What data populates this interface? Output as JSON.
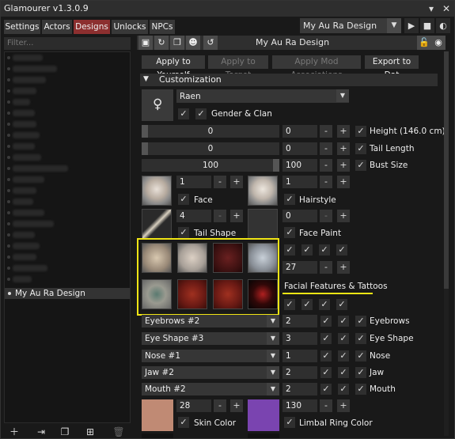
{
  "window": {
    "title": "Glamourer v1.3.0.9"
  },
  "tabs": [
    "Settings",
    "Actors",
    "Designs",
    "Unlocks",
    "NPCs"
  ],
  "active_tab": "Designs",
  "header": {
    "selected_design": "My Au Ra Design"
  },
  "left": {
    "filter_placeholder": "Filter...",
    "selected_item": "My Au Ra Design"
  },
  "right": {
    "title": "My Au Ra Design",
    "buttons": {
      "apply_yourself": "Apply to Yourself",
      "apply_target": "Apply to Target",
      "apply_mod": "Apply Mod Associations",
      "export": "Export to Dat"
    },
    "section": "Customization",
    "clan": "Raen",
    "gender_clan_label": "Gender & Clan",
    "height": {
      "slider": "0",
      "value": "0",
      "label": "Height (146.0 cm)"
    },
    "tail_length": {
      "slider": "0",
      "value": "0",
      "label": "Tail Length"
    },
    "bust_size": {
      "slider": "100",
      "value": "100",
      "label": "Bust Size"
    },
    "face": {
      "value": "1",
      "label": "Face"
    },
    "hairstyle": {
      "value": "1",
      "label": "Hairstyle"
    },
    "tail_shape": {
      "value": "4",
      "label": "Tail Shape"
    },
    "face_paint": {
      "value": "0",
      "label": "Face Paint"
    },
    "facial_features": {
      "value": "27",
      "label": "Facial Features & Tattoos"
    },
    "eyebrows": {
      "select": "Eyebrows #2",
      "value": "2",
      "label": "Eyebrows"
    },
    "eye_shape": {
      "select": "Eye Shape #3",
      "value": "3",
      "label": "Eye Shape"
    },
    "nose": {
      "select": "Nose #1",
      "value": "1",
      "label": "Nose"
    },
    "jaw": {
      "select": "Jaw #2",
      "value": "2",
      "label": "Jaw"
    },
    "mouth": {
      "select": "Mouth #2",
      "value": "2",
      "label": "Mouth"
    },
    "skin_color": {
      "value": "28",
      "label": "Skin Color",
      "swatch": "#c08a74"
    },
    "limbal_ring": {
      "value": "130",
      "label": "Limbal Ring Color",
      "swatch": "#7a44b0"
    },
    "minus": "-",
    "plus": "+"
  },
  "colors": {
    "active_tab": "#8c2f2f",
    "highlight": "#f0e514"
  },
  "icons": [
    "save-icon",
    "undo-icon",
    "copy-icon",
    "user-icon",
    "reset-icon",
    "lock-icon",
    "eye-icon",
    "palette-icon",
    "close-icon",
    "play-icon",
    "stop-icon"
  ]
}
